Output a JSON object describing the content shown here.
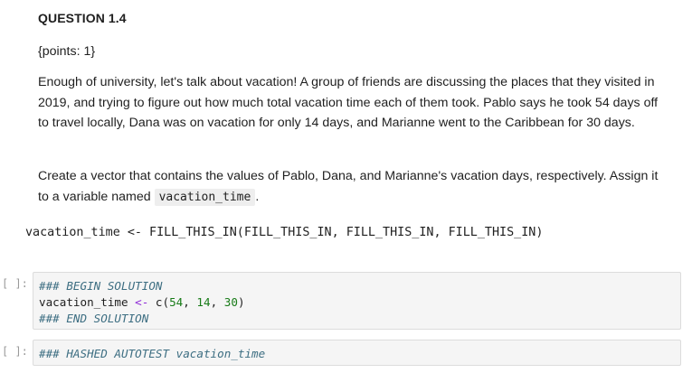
{
  "question": {
    "heading": "QUESTION 1.4",
    "points": "{points: 1}",
    "story": "Enough of university, let's talk about vacation! A group of friends are discussing the places that they visited in 2019, and trying to figure out how much total vacation time each of them took. Pablo says he took 54 days off to travel locally, Dana was on vacation for only 14 days, and Marianne went to the Caribbean for 30 days.",
    "task_before": "Create a vector that contains the values of Pablo, Dana, and Marianne's vacation days, respectively. Assign it to a variable named ",
    "task_code": "vacation_time",
    "task_after": ".",
    "template_code": "vacation_time <- FILL_THIS_IN(FILL_THIS_IN, FILL_THIS_IN, FILL_THIS_IN)"
  },
  "cells": [
    {
      "prompt": "[ ]:",
      "begin_comment": "### BEGIN SOLUTION",
      "code_var": "vacation_time ",
      "code_op": "<-",
      "code_fn": " c(",
      "num1": "54",
      "sep1": ", ",
      "num2": "14",
      "sep2": ", ",
      "num3": "30",
      "close": ")",
      "end_comment": "### END SOLUTION"
    },
    {
      "prompt": "[ ]:",
      "comment": "### HASHED AUTOTEST vacation_time"
    }
  ]
}
